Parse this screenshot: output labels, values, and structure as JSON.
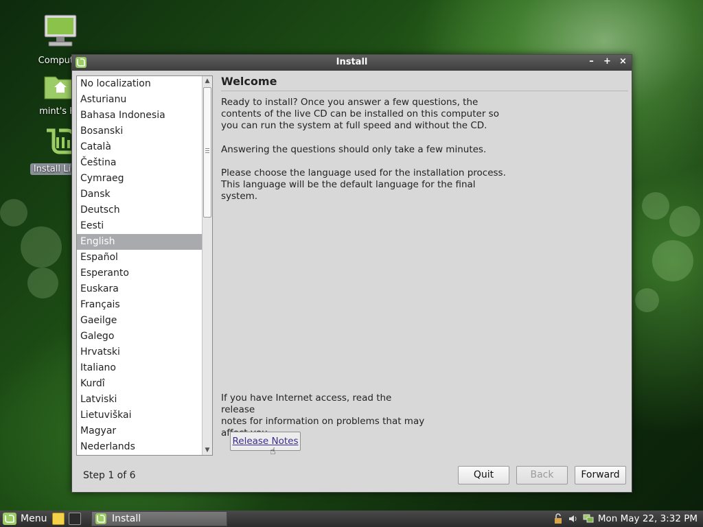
{
  "desktop": {
    "icons": [
      {
        "label": "Computer"
      },
      {
        "label": "mint's Ho"
      },
      {
        "label": "Install Linux"
      }
    ]
  },
  "window": {
    "title": "Install",
    "controls": {
      "minimize": "–",
      "maximize": "+",
      "close": "×"
    }
  },
  "languages": {
    "items": [
      "No localization",
      "Asturianu",
      "Bahasa Indonesia",
      "Bosanski",
      "Català",
      "Čeština",
      "Cymraeg",
      "Dansk",
      "Deutsch",
      "Eesti",
      "English",
      "Español",
      "Esperanto",
      "Euskara",
      "Français",
      "Gaeilge",
      "Galego",
      "Hrvatski",
      "Italiano",
      "Kurdî",
      "Latviski",
      "Lietuviškai",
      "Magyar",
      "Nederlands"
    ],
    "selected": "English"
  },
  "content": {
    "heading": "Welcome",
    "p1_lines": [
      "Ready to install? Once you answer a few questions, the",
      "contents of the live CD can be installed on this computer so",
      "you can run the system at full speed and without the CD."
    ],
    "p2": "Answering the questions should only take a few minutes.",
    "p3_lines": [
      "Please choose the language used for the installation process.",
      "This language will be the default language for the final system."
    ],
    "p4_lines": [
      "If you have Internet access, read the release",
      "notes for information on problems that may",
      "affect you."
    ],
    "release_notes_label": "Release Notes"
  },
  "footer": {
    "step": "Step 1 of 6",
    "quit": "Quit",
    "back": "Back",
    "forward": "Forward"
  },
  "taskbar": {
    "menu_label": "Menu",
    "task_label": "Install",
    "clock": "Mon May 22,  3:32 PM"
  },
  "colors": {
    "mint_green": "#8bc34a",
    "selection": "#a9aaae",
    "link": "#3a2d8c"
  }
}
